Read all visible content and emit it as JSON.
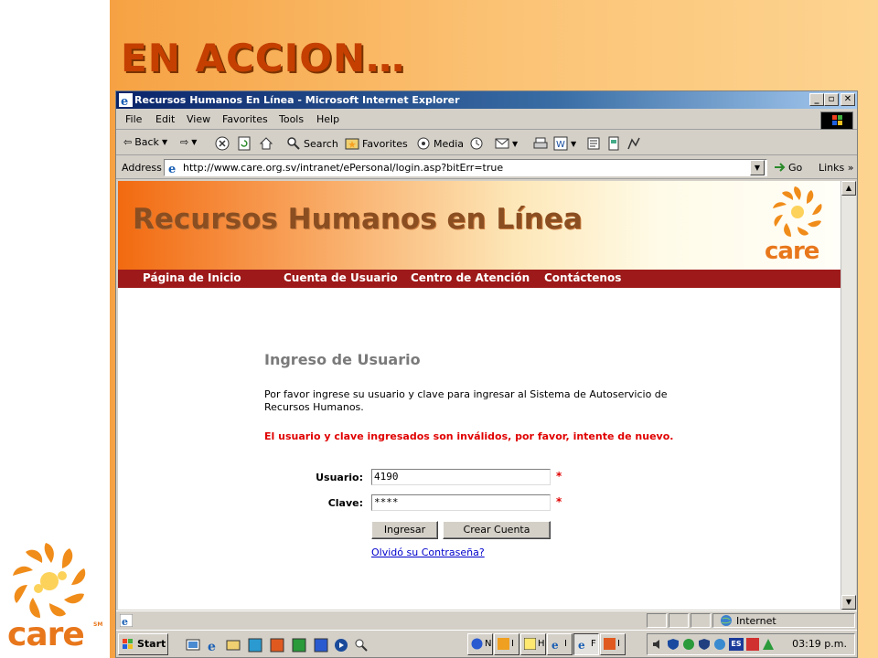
{
  "slide": {
    "title": "EN ACCION…",
    "logo_text": "care",
    "logo_sm": "SM"
  },
  "window": {
    "title": "Recursos Humanos En Línea - Microsoft Internet Explorer",
    "min": "_",
    "max": "▫",
    "close": "✕"
  },
  "menu": [
    "File",
    "Edit",
    "View",
    "Favorites",
    "Tools",
    "Help"
  ],
  "toolbar": {
    "back": "Back",
    "search": "Search",
    "favorites": "Favorites",
    "media": "Media"
  },
  "address": {
    "label": "Address",
    "url": "http://www.care.org.sv/intranet/ePersonal/login.asp?bitErr=true",
    "go": "Go",
    "links": "Links »"
  },
  "page": {
    "banner_title": "Recursos Humanos en Línea",
    "banner_logo": "care",
    "nav": [
      "Página de Inicio",
      "Cuenta de Usuario",
      "Centro de Atención",
      "Contáctenos"
    ],
    "heading": "Ingreso de Usuario",
    "intro": "Por favor ingrese su usuario y clave para ingresar al Sistema de Autoservicio de Recursos Humanos.",
    "error": "El usuario y clave ingresados son inválidos, por favor, intente de nuevo.",
    "user_label": "Usuario:",
    "user_value": "4190",
    "pass_label": "Clave:",
    "pass_value": "****",
    "required_mark": "*",
    "login_button": "Ingresar",
    "create_button": "Crear Cuenta",
    "forgot_link": "Olvidó su Contraseña?"
  },
  "status": {
    "zone": "Internet"
  },
  "taskbar": {
    "start": "Start",
    "tasks": [
      "N",
      "I",
      "H",
      "I",
      "F",
      "I"
    ],
    "tray_lang": "ES",
    "clock": "03:19 p.m."
  },
  "colors": {
    "slide_title": "#c43f00",
    "navbar": "#9e1a1a",
    "error": "#e00000",
    "link": "#0000cc"
  }
}
